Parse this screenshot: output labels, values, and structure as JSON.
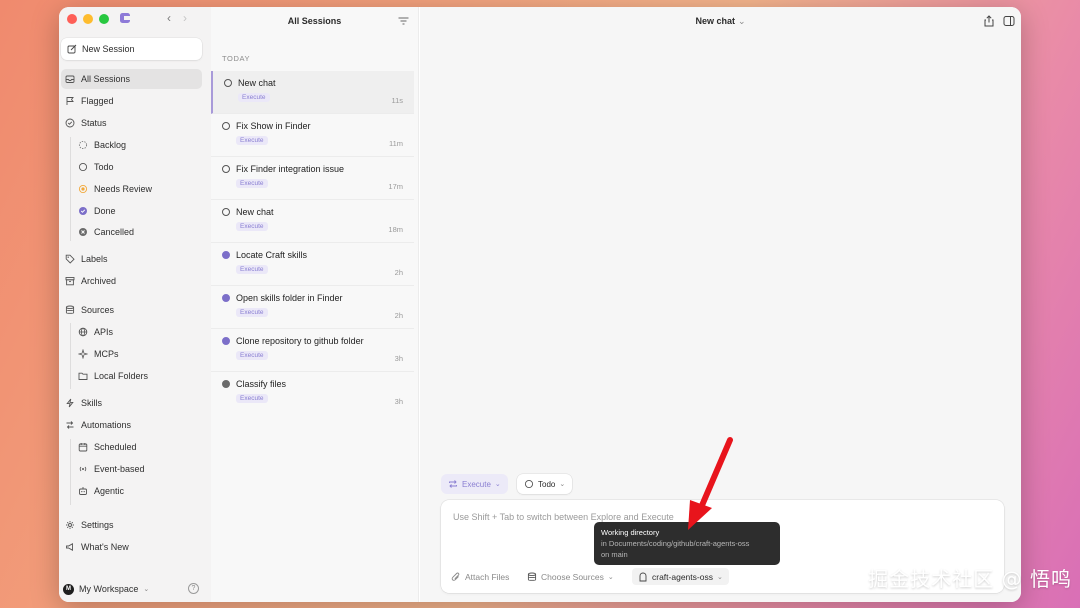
{
  "sidebar": {
    "new_session": "New Session",
    "items": [
      {
        "label": "All Sessions"
      },
      {
        "label": "Flagged"
      },
      {
        "label": "Status"
      },
      {
        "label": "Backlog"
      },
      {
        "label": "Todo"
      },
      {
        "label": "Needs Review"
      },
      {
        "label": "Done"
      },
      {
        "label": "Cancelled"
      },
      {
        "label": "Labels"
      },
      {
        "label": "Archived"
      },
      {
        "label": "Sources"
      },
      {
        "label": "APIs"
      },
      {
        "label": "MCPs"
      },
      {
        "label": "Local Folders"
      },
      {
        "label": "Skills"
      },
      {
        "label": "Automations"
      },
      {
        "label": "Scheduled"
      },
      {
        "label": "Event-based"
      },
      {
        "label": "Agentic"
      },
      {
        "label": "Settings"
      },
      {
        "label": "What's New"
      }
    ],
    "workspace": {
      "avatar": "M",
      "label": "My Workspace"
    },
    "colors": {
      "needs_review": "#f2a93b",
      "done": "#7c6fc9",
      "cancelled": "#6b6b6b"
    }
  },
  "sessions": {
    "title": "All Sessions",
    "section": "TODAY",
    "items": [
      {
        "title": "New chat",
        "badge": "Execute",
        "time": "11s",
        "status": "todo"
      },
      {
        "title": "Fix Show in Finder",
        "badge": "Execute",
        "time": "11m",
        "status": "todo"
      },
      {
        "title": "Fix Finder integration issue",
        "badge": "Execute",
        "time": "17m",
        "status": "todo"
      },
      {
        "title": "New chat",
        "badge": "Execute",
        "time": "18m",
        "status": "todo"
      },
      {
        "title": "Locate Craft skills",
        "badge": "Execute",
        "time": "2h",
        "status": "done"
      },
      {
        "title": "Open skills folder in Finder",
        "badge": "Execute",
        "time": "2h",
        "status": "done"
      },
      {
        "title": "Clone repository to github folder",
        "badge": "Execute",
        "time": "3h",
        "status": "done"
      },
      {
        "title": "Classify files",
        "badge": "Execute",
        "time": "3h",
        "status": "cancelled"
      }
    ]
  },
  "main": {
    "title": "New chat",
    "mode_chip": "Execute",
    "status_chip": "Todo",
    "composer_placeholder": "Use Shift + Tab to switch between Explore and Execute",
    "attach": "Attach Files",
    "sources": "Choose Sources",
    "directory": "craft-agents-oss",
    "tooltip": {
      "title": "Working directory",
      "path": "in Documents/coding/github/craft-agents-oss",
      "branch": "on main"
    }
  },
  "watermark": "掘金技术社区 @ 悟鸣"
}
